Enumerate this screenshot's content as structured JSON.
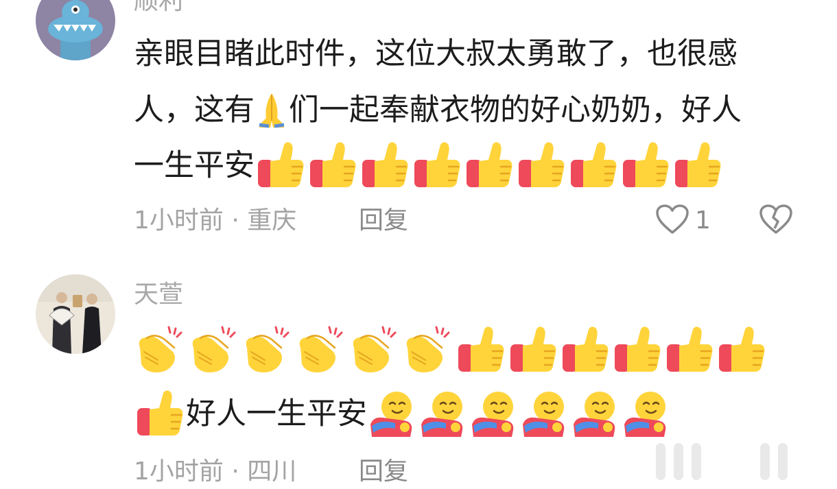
{
  "comments": [
    {
      "username": "顺利",
      "text_line1": "亲眼目睹此时件，这位大叔太勇敢了，也很感",
      "text_line2_a": "人，这有",
      "text_line2_b": "们一起奉献衣物的好心奶奶，好人",
      "text_line3": "一生平安",
      "emoji_inline": "pray-emoji",
      "emojis_line3": [
        "thumbs-up-emoji",
        "thumbs-up-emoji",
        "thumbs-up-emoji",
        "thumbs-up-emoji",
        "thumbs-up-emoji",
        "thumbs-up-emoji",
        "thumbs-up-emoji",
        "thumbs-up-emoji",
        "thumbs-up-emoji"
      ],
      "time": "1小时前",
      "location": "重庆",
      "separator": " · ",
      "reply_label": "回复",
      "like_count": "1",
      "avatar_icon": "blue-monster-icon"
    },
    {
      "username": "天萱",
      "emojis_line1": [
        "clapping-emoji",
        "clapping-emoji",
        "clapping-emoji",
        "clapping-emoji",
        "clapping-emoji",
        "clapping-emoji",
        "thumbs-up-emoji",
        "thumbs-up-emoji",
        "thumbs-up-emoji",
        "thumbs-up-emoji",
        "thumbs-up-emoji",
        "thumbs-up-emoji"
      ],
      "text_line2": "好人一生平安",
      "emojis_line2": [
        "hugging-face-emoji",
        "hugging-face-emoji",
        "hugging-face-emoji",
        "hugging-face-emoji",
        "hugging-face-emoji",
        "hugging-face-emoji"
      ],
      "time": "1小时前",
      "location": "四川",
      "separator": " · ",
      "reply_label": "回复",
      "avatar_icon": "photo-avatar"
    }
  ],
  "colors": {
    "muted_text": "#a8a8a8",
    "body_text": "#1c1c1c",
    "emoji_yellow": "#ffd43b",
    "emoji_red": "#ee4a5a",
    "avatar_purple": "#8e84a4"
  }
}
